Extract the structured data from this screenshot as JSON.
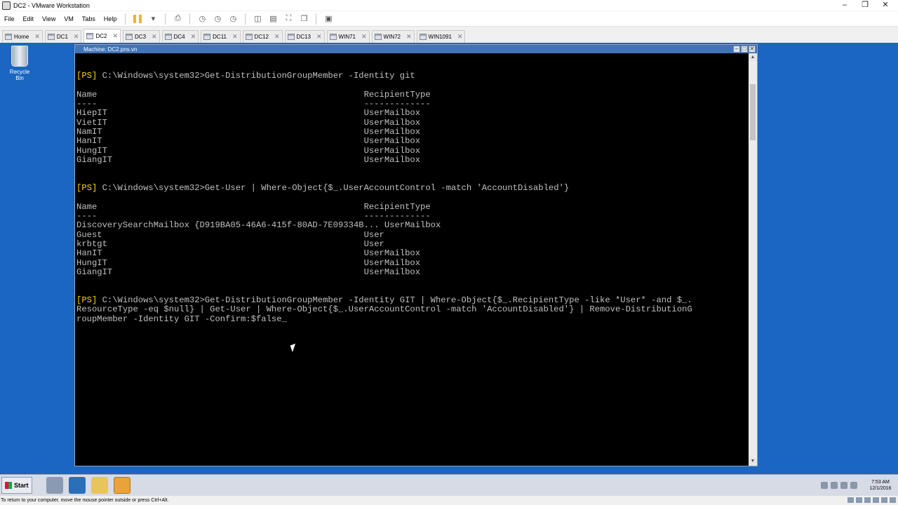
{
  "window": {
    "title": "DC2 - VMware Workstation"
  },
  "menu": [
    "File",
    "Edit",
    "View",
    "VM",
    "Tabs",
    "Help"
  ],
  "tabs": [
    {
      "label": "Home",
      "active": false
    },
    {
      "label": "DC1",
      "active": false
    },
    {
      "label": "DC2",
      "active": true
    },
    {
      "label": "DC3",
      "active": false
    },
    {
      "label": "DC4",
      "active": false
    },
    {
      "label": "DC11",
      "active": false
    },
    {
      "label": "DC12",
      "active": false
    },
    {
      "label": "DC13",
      "active": false
    },
    {
      "label": "WIN71",
      "active": false
    },
    {
      "label": "WIN72",
      "active": false
    },
    {
      "label": "WIN1091",
      "active": false
    }
  ],
  "desktop": {
    "recycle_bin_label": "Recycle Bin"
  },
  "vm_window": {
    "title": "Machine: DC2.pns.vn"
  },
  "console": {
    "prompt_tag": "[PS]",
    "lines": [
      {
        "type": "cmd",
        "prompt": " C:\\Windows\\system32>",
        "text": "Get-DistributionGroupMember -Identity git"
      },
      {
        "type": "out",
        "text": ""
      },
      {
        "type": "out",
        "text": "Name                                                    RecipientType"
      },
      {
        "type": "out",
        "text": "----                                                    -------------"
      },
      {
        "type": "out",
        "text": "HiepIT                                                  UserMailbox"
      },
      {
        "type": "out",
        "text": "VietIT                                                  UserMailbox"
      },
      {
        "type": "out",
        "text": "NamIT                                                   UserMailbox"
      },
      {
        "type": "out",
        "text": "HanIT                                                   UserMailbox"
      },
      {
        "type": "out",
        "text": "HungIT                                                  UserMailbox"
      },
      {
        "type": "out",
        "text": "GiangIT                                                 UserMailbox"
      },
      {
        "type": "out",
        "text": ""
      },
      {
        "type": "out",
        "text": ""
      },
      {
        "type": "cmd",
        "prompt": " C:\\Windows\\system32>",
        "text": "Get-User | Where-Object{$_.UserAccountControl -match 'AccountDisabled'}"
      },
      {
        "type": "out",
        "text": ""
      },
      {
        "type": "out",
        "text": "Name                                                    RecipientType"
      },
      {
        "type": "out",
        "text": "----                                                    -------------"
      },
      {
        "type": "out",
        "text": "DiscoverySearchMailbox {D919BA05-46A6-415f-80AD-7E09334B... UserMailbox"
      },
      {
        "type": "out",
        "text": "Guest                                                   User"
      },
      {
        "type": "out",
        "text": "krbtgt                                                  User"
      },
      {
        "type": "out",
        "text": "HanIT                                                   UserMailbox"
      },
      {
        "type": "out",
        "text": "HungIT                                                  UserMailbox"
      },
      {
        "type": "out",
        "text": "GiangIT                                                 UserMailbox"
      },
      {
        "type": "out",
        "text": ""
      },
      {
        "type": "out",
        "text": ""
      },
      {
        "type": "cmd",
        "prompt": " C:\\Windows\\system32>",
        "text": "Get-DistributionGroupMember -Identity GIT | Where-Object{$_.RecipientType -like *User* -and $_."
      },
      {
        "type": "out",
        "text": "ResourceType -eq $null} | Get-User | Where-Object{$_.UserAccountControl -match 'AccountDisabled'} | Remove-DistributionG"
      },
      {
        "type": "out",
        "text": "roupMember -Identity GIT -Confirm:$false_"
      }
    ]
  },
  "taskbar": {
    "start_label": "Start",
    "clock_time": "7:53 AM",
    "clock_date": "12/1/2016"
  },
  "statusbar": {
    "text": "To return to your computer, move the mouse pointer outside or press Ctrl+Alt."
  }
}
